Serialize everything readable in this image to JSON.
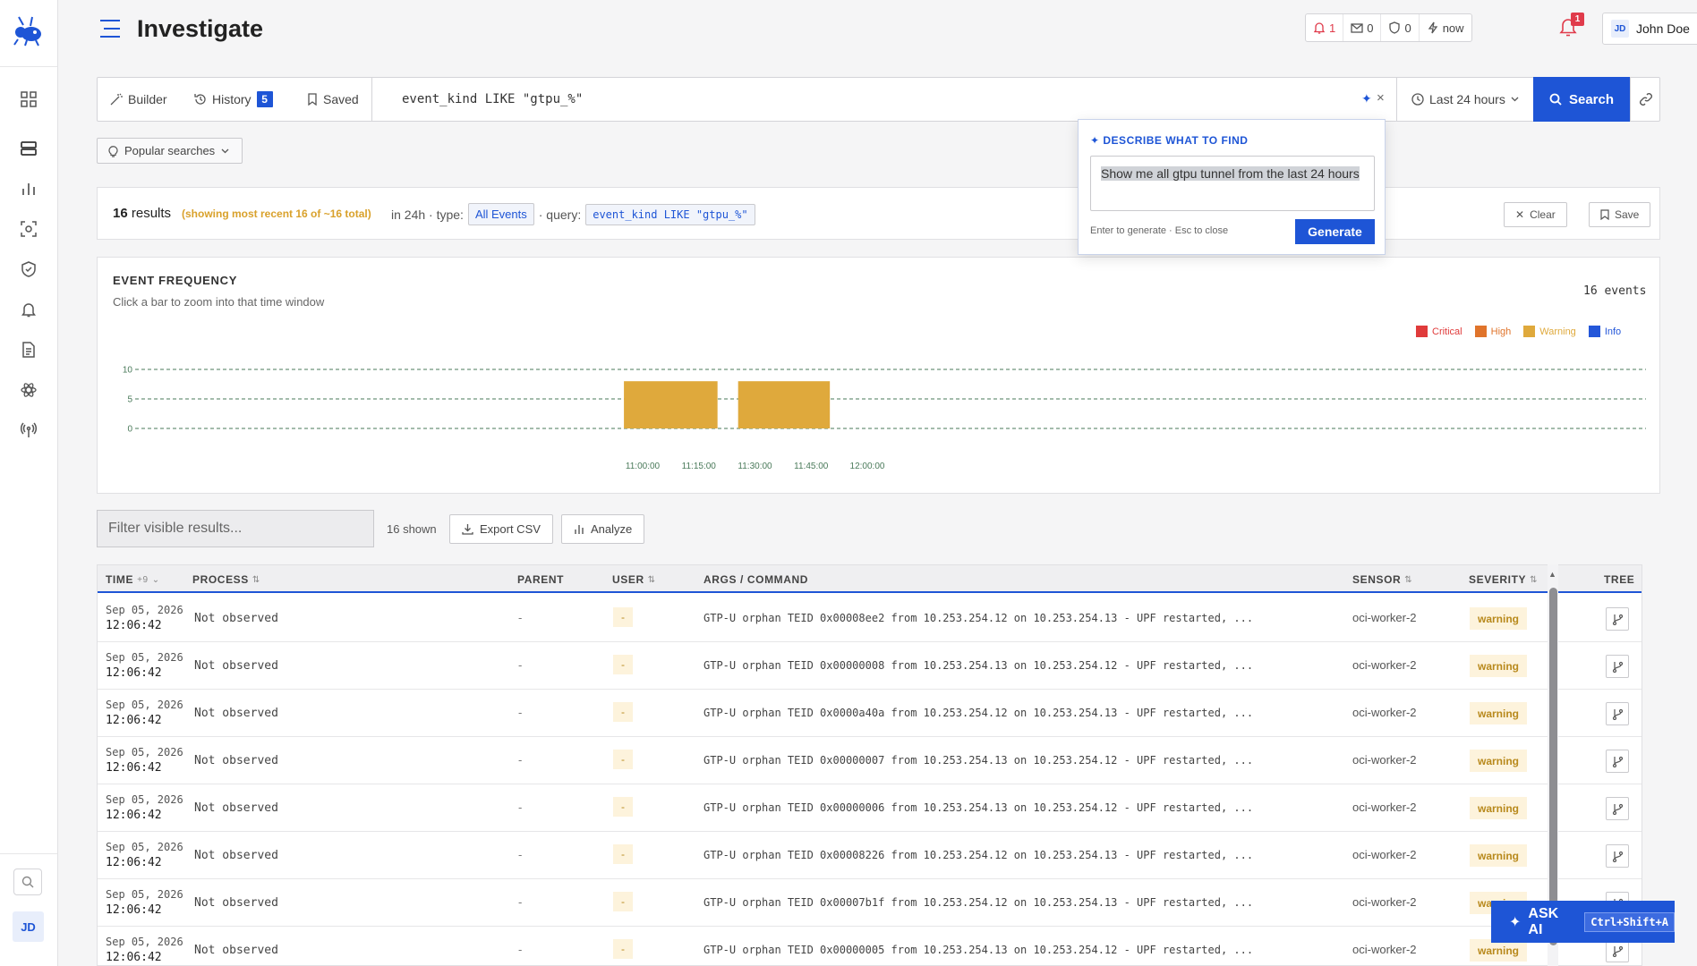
{
  "app": {
    "title": "Investigate"
  },
  "header": {
    "status": [
      {
        "icon": "bell-icon",
        "value": "1",
        "critical": true
      },
      {
        "icon": "mail-x-icon",
        "value": "0"
      },
      {
        "icon": "shield-icon",
        "value": "0"
      },
      {
        "icon": "bolt-icon",
        "value": "now"
      }
    ],
    "notification_count": "1",
    "user": {
      "initials": "JD",
      "name": "John Doe"
    }
  },
  "sidebar": {
    "items": [
      "dashboard-icon",
      "server-icon",
      "bar-chart-icon",
      "scan-icon",
      "shield-icon",
      "bell-icon",
      "file-icon",
      "atom-icon",
      "antenna-icon"
    ],
    "avatar": "JD"
  },
  "query": {
    "builder_label": "Builder",
    "history_label": "History",
    "history_count": "5",
    "saved_label": "Saved",
    "text": "event_kind LIKE \"gtpu_%\"",
    "range_label": "Last 24 hours",
    "search_label": "Search"
  },
  "popular_label": "Popular searches",
  "ai_popover": {
    "title": "DESCRIBE WHAT TO FIND",
    "prompt": "Show me all gtpu tunnel from the last 24 hours",
    "hint": "Enter to generate · Esc to close",
    "generate_label": "Generate"
  },
  "summary": {
    "count": "16",
    "count_label": "results",
    "note": "(showing most recent 16 of ~16 total)",
    "window_text": "in 24h · type:",
    "type_value": "All Events",
    "query_prefix": "· query:",
    "query_value": "event_kind LIKE \"gtpu_%\"",
    "clear_label": "Clear",
    "save_label": "Save"
  },
  "chart_panel": {
    "title": "EVENT FREQUENCY",
    "subtitle": "Click a bar to zoom into that time window",
    "count_label": "16 events"
  },
  "chart_data": {
    "type": "bar",
    "title": "EVENT FREQUENCY",
    "x_ticks": [
      "11:00:00",
      "11:15:00",
      "11:30:00",
      "11:45:00",
      "12:00:00"
    ],
    "y_ticks": [
      0,
      5,
      10
    ],
    "ylim": [
      0,
      10
    ],
    "legend_placement": "top-right",
    "series": [
      {
        "name": "Critical",
        "color": "#e03b3b"
      },
      {
        "name": "High",
        "color": "#e0742b"
      },
      {
        "name": "Warning",
        "color": "#dfa93c"
      },
      {
        "name": "Info",
        "color": "#2457d9"
      }
    ],
    "bars": [
      {
        "series": "Warning",
        "x_start": "10:55:00",
        "x_end": "11:20:00",
        "value": 8
      },
      {
        "series": "Warning",
        "x_start": "11:25:30",
        "x_end": "11:50:00",
        "value": 8
      }
    ],
    "grid": true
  },
  "results_toolbar": {
    "filter_placeholder": "Filter visible results...",
    "shown_label": "16 shown",
    "export_label": "Export CSV",
    "analyze_label": "Analyze"
  },
  "table": {
    "columns": {
      "time": "TIME",
      "time_extra": "+9",
      "process": "PROCESS",
      "parent": "PARENT",
      "user": "USER",
      "args": "ARGS / COMMAND",
      "sensor": "SENSOR",
      "severity": "SEVERITY",
      "tree": "TREE"
    },
    "rows": [
      {
        "date": "Sep 05, 2026",
        "time": "12:06:42",
        "process": "Not observed",
        "parent": "-",
        "user": "-",
        "args": "GTP-U orphan TEID 0x00008ee2 from 10.253.254.12 on 10.253.254.13 - UPF restarted, ...",
        "sensor": "oci-worker-2",
        "severity": "warning"
      },
      {
        "date": "Sep 05, 2026",
        "time": "12:06:42",
        "process": "Not observed",
        "parent": "-",
        "user": "-",
        "args": "GTP-U orphan TEID 0x00000008 from 10.253.254.13 on 10.253.254.12 - UPF restarted, ...",
        "sensor": "oci-worker-2",
        "severity": "warning"
      },
      {
        "date": "Sep 05, 2026",
        "time": "12:06:42",
        "process": "Not observed",
        "parent": "-",
        "user": "-",
        "args": "GTP-U orphan TEID 0x0000a40a from 10.253.254.12 on 10.253.254.13 - UPF restarted, ...",
        "sensor": "oci-worker-2",
        "severity": "warning"
      },
      {
        "date": "Sep 05, 2026",
        "time": "12:06:42",
        "process": "Not observed",
        "parent": "-",
        "user": "-",
        "args": "GTP-U orphan TEID 0x00000007 from 10.253.254.13 on 10.253.254.12 - UPF restarted, ...",
        "sensor": "oci-worker-2",
        "severity": "warning"
      },
      {
        "date": "Sep 05, 2026",
        "time": "12:06:42",
        "process": "Not observed",
        "parent": "-",
        "user": "-",
        "args": "GTP-U orphan TEID 0x00000006 from 10.253.254.13 on 10.253.254.12 - UPF restarted, ...",
        "sensor": "oci-worker-2",
        "severity": "warning"
      },
      {
        "date": "Sep 05, 2026",
        "time": "12:06:42",
        "process": "Not observed",
        "parent": "-",
        "user": "-",
        "args": "GTP-U orphan TEID 0x00008226 from 10.253.254.12 on 10.253.254.13 - UPF restarted, ...",
        "sensor": "oci-worker-2",
        "severity": "warning"
      },
      {
        "date": "Sep 05, 2026",
        "time": "12:06:42",
        "process": "Not observed",
        "parent": "-",
        "user": "-",
        "args": "GTP-U orphan TEID 0x00007b1f from 10.253.254.12 on 10.253.254.13 - UPF restarted, ...",
        "sensor": "oci-worker-2",
        "severity": "warning"
      },
      {
        "date": "Sep 05, 2026",
        "time": "12:06:42",
        "process": "Not observed",
        "parent": "-",
        "user": "-",
        "args": "GTP-U orphan TEID 0x00000005 from 10.253.254.13 on 10.253.254.12 - UPF restarted, ...",
        "sensor": "oci-worker-2",
        "severity": "warning"
      }
    ]
  },
  "ask_ai": {
    "label": "ASK AI",
    "shortcut": "Ctrl+Shift+A"
  }
}
